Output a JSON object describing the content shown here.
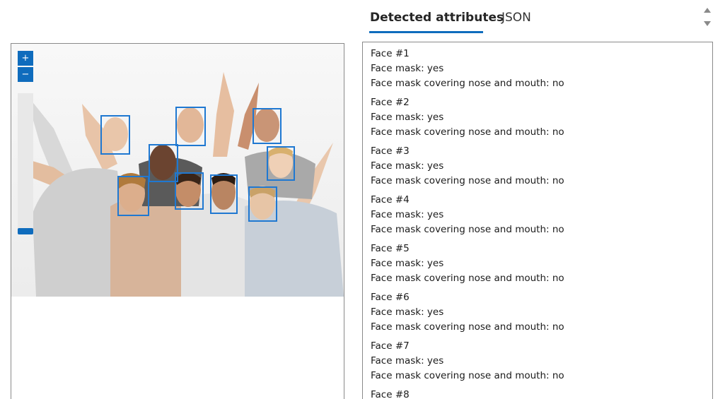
{
  "tabs": [
    {
      "label": "Detected attributes",
      "active": true
    },
    {
      "label": "JSON",
      "active": false
    }
  ],
  "viewer": {
    "zoom_in_label": "+",
    "zoom_out_label": "−",
    "face_box_color": "#1f78d1"
  },
  "results": {
    "faces": [
      {
        "title": "Face #1",
        "mask": "Face mask: yes",
        "covering": "Face mask covering nose and mouth: no"
      },
      {
        "title": "Face #2",
        "mask": "Face mask: yes",
        "covering": "Face mask covering nose and mouth: no"
      },
      {
        "title": "Face #3",
        "mask": "Face mask: yes",
        "covering": "Face mask covering nose and mouth: no"
      },
      {
        "title": "Face #4",
        "mask": "Face mask: yes",
        "covering": "Face mask covering nose and mouth: no"
      },
      {
        "title": "Face #5",
        "mask": "Face mask: yes",
        "covering": "Face mask covering nose and mouth: no"
      },
      {
        "title": "Face #6",
        "mask": "Face mask: yes",
        "covering": "Face mask covering nose and mouth: no"
      },
      {
        "title": "Face #7",
        "mask": "Face mask: yes",
        "covering": "Face mask covering nose and mouth: no"
      },
      {
        "title": "Face #8",
        "mask": "",
        "covering": ""
      }
    ]
  },
  "colors": {
    "accent": "#0f6cbd",
    "border": "#8a8a8a"
  }
}
